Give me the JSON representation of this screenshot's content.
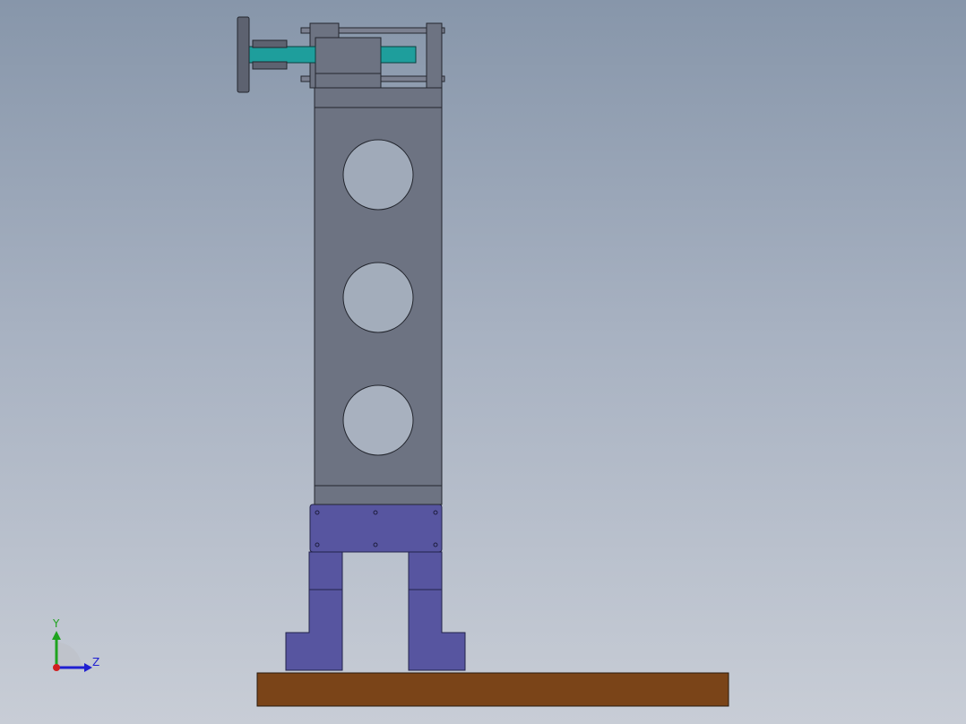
{
  "viewport": {
    "background_top": "#8796aa",
    "background_bottom": "#c8cdd6"
  },
  "colors": {
    "column_body": "#6d7382",
    "column_outline": "#23262e",
    "hole_fill": "#a0aab9",
    "screw_cyan": "#1e9e9c",
    "mount_plate": "#5755a0",
    "legs": "#5755a0",
    "floor_board": "#7a4418",
    "handwheel": "#5d6270"
  },
  "triad": {
    "y_label": "Y",
    "z_label": "Z",
    "y_color": "#1fa31f",
    "z_color": "#1f1fd1",
    "x_color": "#d11f1f",
    "icon": "coordinate-triad-icon"
  }
}
